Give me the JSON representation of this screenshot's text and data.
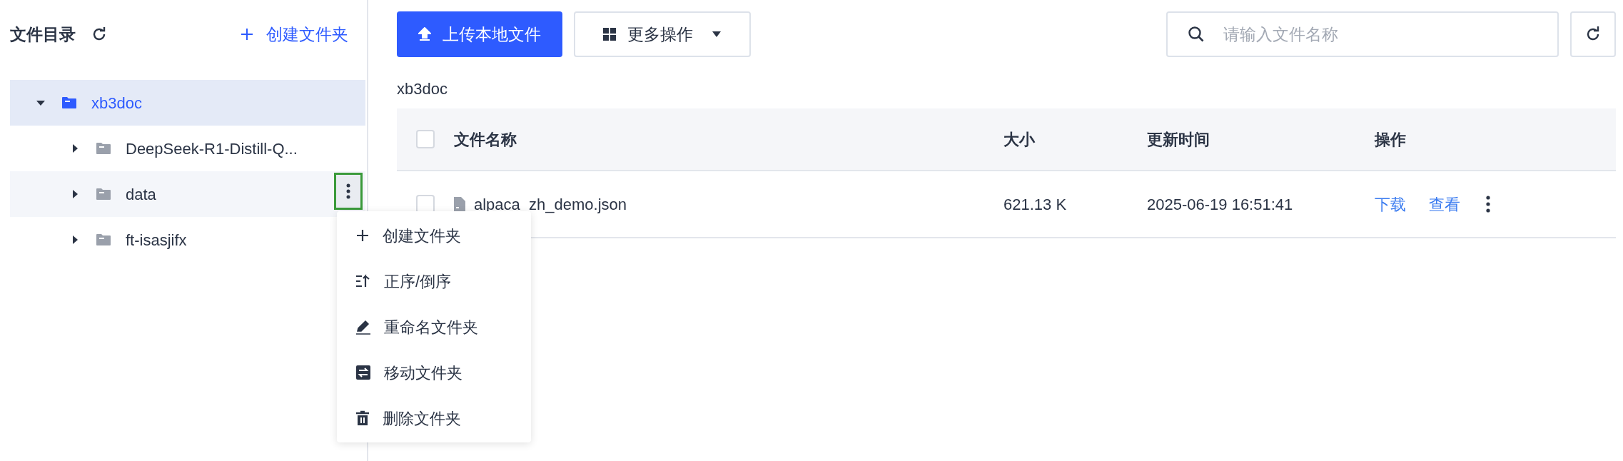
{
  "sidebar": {
    "title": "文件目录",
    "create_folder": "创建文件夹",
    "tree": [
      {
        "label": "xb3doc",
        "selected": true,
        "expanded": true,
        "hovered": false,
        "children": [
          {
            "label": "DeepSeek-R1-Distill-Q...",
            "selected": false,
            "expanded": false,
            "hovered": false
          },
          {
            "label": "data",
            "selected": false,
            "expanded": false,
            "hovered": true
          },
          {
            "label": "ft-isasjifx",
            "selected": false,
            "expanded": false,
            "hovered": false
          }
        ]
      }
    ]
  },
  "context_menu": [
    {
      "kind": "plus",
      "label": "创建文件夹"
    },
    {
      "kind": "sort",
      "label": "正序/倒序"
    },
    {
      "kind": "rename",
      "label": "重命名文件夹"
    },
    {
      "kind": "move",
      "label": "移动文件夹"
    },
    {
      "kind": "delete",
      "label": "删除文件夹"
    }
  ],
  "toolbar": {
    "upload": "上传本地文件",
    "more": "更多操作",
    "search": {
      "placeholder": "请输入文件名称"
    }
  },
  "breadcrumb": "xb3doc",
  "table": {
    "all_checked": false,
    "columns": [
      "文件名称",
      "大小",
      "更新时间",
      "操作"
    ],
    "rows": [
      {
        "checked": false,
        "name": "alpaca_zh_demo.json",
        "size": "621.13 K",
        "updated": "2025-06-19 16:51:41",
        "actions": [
          "下载",
          "查看"
        ]
      }
    ]
  }
}
